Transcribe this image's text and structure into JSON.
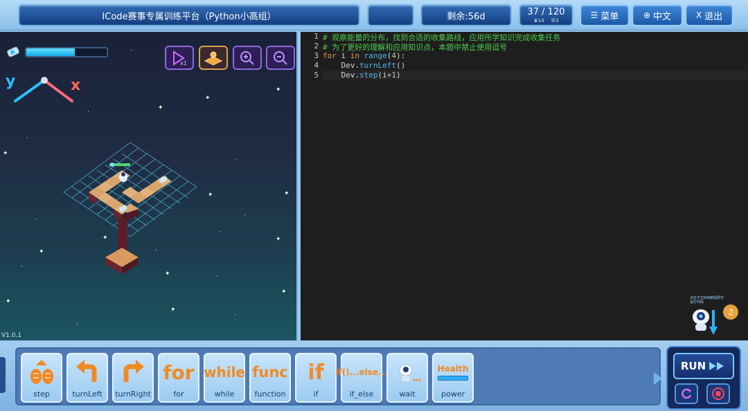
{
  "header": {
    "title": "ICode赛事专属训练平台（Python小高组）",
    "remaining": "剩余:56d",
    "progress": {
      "current": "37 / 120",
      "stat1": "14",
      "stat2": "3"
    },
    "menu_label": "菜单",
    "lang_label": "中文",
    "exit_label": "退出"
  },
  "game": {
    "axis_y": "y",
    "axis_x": "x",
    "energy_level": 0.6,
    "version": "V1.0.1",
    "tools": [
      "speed-x1-icon",
      "map-icon",
      "zoom-in-icon",
      "zoom-out-icon"
    ],
    "speed_label": "x1"
  },
  "editor": {
    "line_numbers": [
      "1",
      "2",
      "3",
      "4",
      "5"
    ],
    "lines": {
      "l1": "# 观察能量的分布，找到合适的收集路线，应用所学知识完成收集任务",
      "l2": "# 为了更好的理解和应用知识点，本题中禁止使用逗号",
      "l3_kw_for": "for",
      "l3_var": " i ",
      "l3_kw_in": "in",
      "l3_fn": " range",
      "l3_open": "(",
      "l3_num": "4",
      "l3_close": "):",
      "l4_obj": "    Dev.",
      "l4_method": "turnLeft",
      "l4_args": "()",
      "l5_obj": "    Dev.",
      "l5_method": "step",
      "l5_args_open": "(i+",
      "l5_num": "1",
      "l5_args_close": ")"
    },
    "helper_text": "点击下方RUN按钮即可运行代码"
  },
  "blocks": [
    {
      "label": "step",
      "glyph": "step-icon"
    },
    {
      "label": "turnLeft",
      "glyph": "turn-left-icon"
    },
    {
      "label": "turnRight",
      "glyph": "turn-right-icon"
    },
    {
      "label": "for",
      "glyph": "for"
    },
    {
      "label": "while",
      "glyph": "while"
    },
    {
      "label": "function",
      "glyph": "func"
    },
    {
      "label": "if",
      "glyph": "if"
    },
    {
      "label": "if_else",
      "glyph": "if()...else..."
    },
    {
      "label": "wait",
      "glyph": "robot-icon"
    },
    {
      "label": "power",
      "glyph": "Health"
    }
  ],
  "run": {
    "label": "RUN"
  },
  "colors": {
    "accent": "#1d5aa8",
    "comment": "#4ec94e",
    "keyword": "#e89a3c",
    "builtin": "#55b6f0",
    "block_orange": "#f08a24"
  }
}
